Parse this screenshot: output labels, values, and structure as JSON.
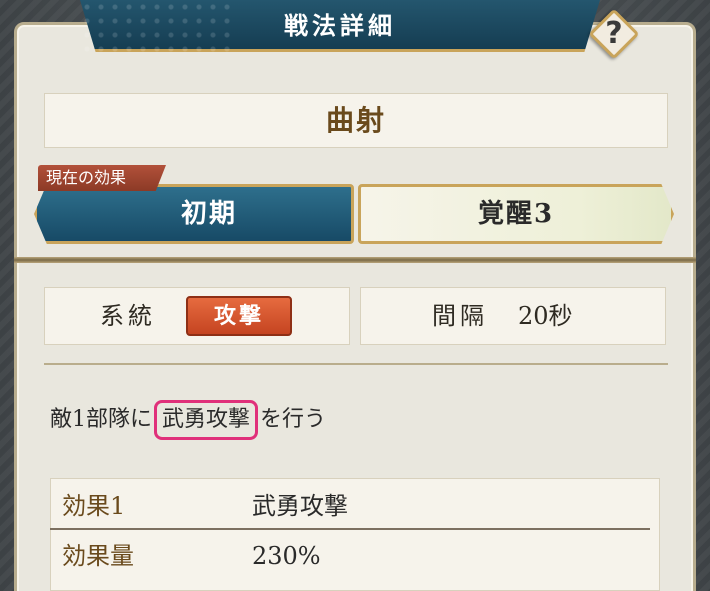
{
  "header": {
    "title": "戦法詳細",
    "help_label": "?"
  },
  "tactic": {
    "name": "曲射"
  },
  "tabs": {
    "current_effect_badge": "現在の効果",
    "initial_label": "初期",
    "awaken_label": "覚醒3"
  },
  "stats": {
    "system_label": "系統",
    "system_value": "攻撃",
    "interval_label": "間隔",
    "interval_value": "20秒"
  },
  "description": {
    "prefix": "敵1部隊に",
    "highlight": "武勇攻撃",
    "suffix": "を行う"
  },
  "effects": {
    "rows": [
      {
        "label": "効果1",
        "value": "武勇攻撃"
      },
      {
        "label": "効果量",
        "value": "230%"
      }
    ]
  },
  "colors": {
    "banner": "#174a66",
    "accent_gold": "#c9a45a",
    "attack_badge": "#c54421",
    "highlight_border": "#e0307a"
  }
}
